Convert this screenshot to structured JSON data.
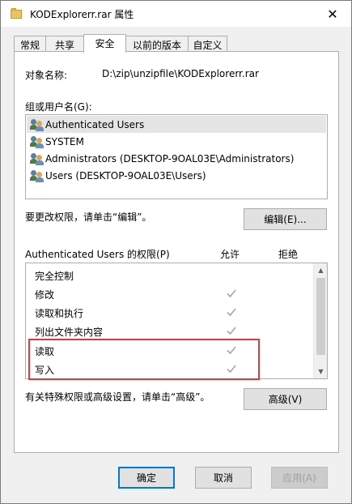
{
  "window": {
    "title": "KODExplorerr.rar 属性",
    "close_glyph": "✕"
  },
  "tabs": [
    {
      "label": "常规"
    },
    {
      "label": "共享"
    },
    {
      "label": "安全",
      "active": true
    },
    {
      "label": "以前的版本"
    },
    {
      "label": "自定义"
    }
  ],
  "security": {
    "object_name_label": "对象名称:",
    "object_name_value": "D:\\zip\\unzipfile\\KODExplorerr.rar",
    "group_label": "组或用户名(G):",
    "users": [
      {
        "name": "Authenticated Users",
        "selected": true
      },
      {
        "name": "SYSTEM"
      },
      {
        "name": "Administrators (DESKTOP-9OAL03E\\Administrators)"
      },
      {
        "name": "Users (DESKTOP-9OAL03E\\Users)"
      }
    ],
    "change_hint": "要更改权限，请单击“编辑”。",
    "edit_button": "编辑(E)...",
    "permissions_label": "Authenticated Users 的权限(P)",
    "allow_header": "允许",
    "deny_header": "拒绝",
    "permissions": [
      {
        "name": "完全控制",
        "allow": false
      },
      {
        "name": "修改",
        "allow": true
      },
      {
        "name": "读取和执行",
        "allow": true
      },
      {
        "name": "列出文件夹内容",
        "allow": true
      },
      {
        "name": "读取",
        "allow": true
      },
      {
        "name": "写入",
        "allow": true
      }
    ],
    "advanced_hint": "有关特殊权限或高级设置，请单击“高级”。",
    "advanced_button": "高级(V)"
  },
  "footer": {
    "ok": "确定",
    "cancel": "取消",
    "apply": "应用(A)"
  },
  "colors": {
    "accent": "#0078d7",
    "highlight_border": "#e0393e",
    "check": "#a6a6a6"
  }
}
